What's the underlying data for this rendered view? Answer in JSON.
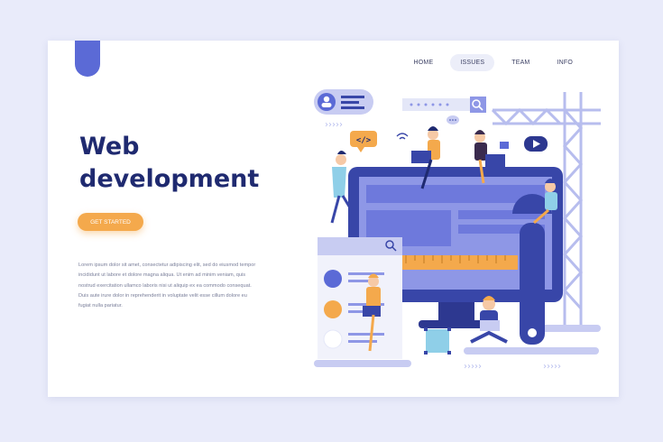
{
  "nav": {
    "items": [
      {
        "label": "HOME"
      },
      {
        "label": "ISSUES",
        "active": true
      },
      {
        "label": "TEAM"
      },
      {
        "label": "INFO"
      }
    ]
  },
  "hero": {
    "title": "Web development",
    "cta_label": "GET STARTED",
    "description": "Lorem ipsum dolor sit amet, consectetur adipiscing elit, sed do eiusmod tempor incididunt ut labore et dolore magna aliqua. Ut enim ad minim veniam, quis nostrud exercitation ullamco laboris nisi ut aliquip ex ea commodo consequat. Duis aute irure dolor in reprehenderit in voluptate velit esse cillum dolore eu fugiat nulla pariatur."
  },
  "illustration": {
    "code_bubble": "</>",
    "icons": [
      "user-icon",
      "search-icon",
      "play-icon",
      "wifi-icon",
      "speech-bubble-icon",
      "code-icon",
      "wrench-icon",
      "crane-icon"
    ]
  },
  "colors": {
    "background": "#e9ebfa",
    "primary": "#1f2a70",
    "accent": "#5b6ad6",
    "cta": "#f4a94c",
    "monitor": "#3846a8",
    "light_purple": "#c8ccf2"
  }
}
